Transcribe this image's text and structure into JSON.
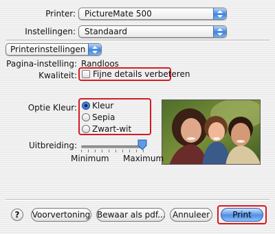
{
  "printer": {
    "label": "Printer:",
    "value": "PictureMate 500"
  },
  "instellingen": {
    "label": "Instellingen:",
    "value": "Standaard"
  },
  "panel": {
    "value": "Printerinstellingen"
  },
  "pagina": {
    "label": "Pagina-instelling:",
    "value": "Randloos"
  },
  "kwaliteit": {
    "label": "Kwaliteit:",
    "checkbox_label": "Fijne details verbeteren"
  },
  "optie_kleur": {
    "label": "Optie Kleur:",
    "options": [
      "Kleur",
      "Sepia",
      "Zwart-wit"
    ],
    "selected": "Kleur"
  },
  "uitbreiding": {
    "label": "Uitbreiding:",
    "min": "Minimum",
    "max": "Maximum",
    "value_fraction": 1.0
  },
  "buttons": {
    "help": "?",
    "preview": "Voorvertoning",
    "save_pdf": "Bewaar als pdf...",
    "cancel": "Annuleer",
    "print": "Print"
  },
  "colors": {
    "highlight": "#d41820",
    "accent": "#3f84df"
  }
}
